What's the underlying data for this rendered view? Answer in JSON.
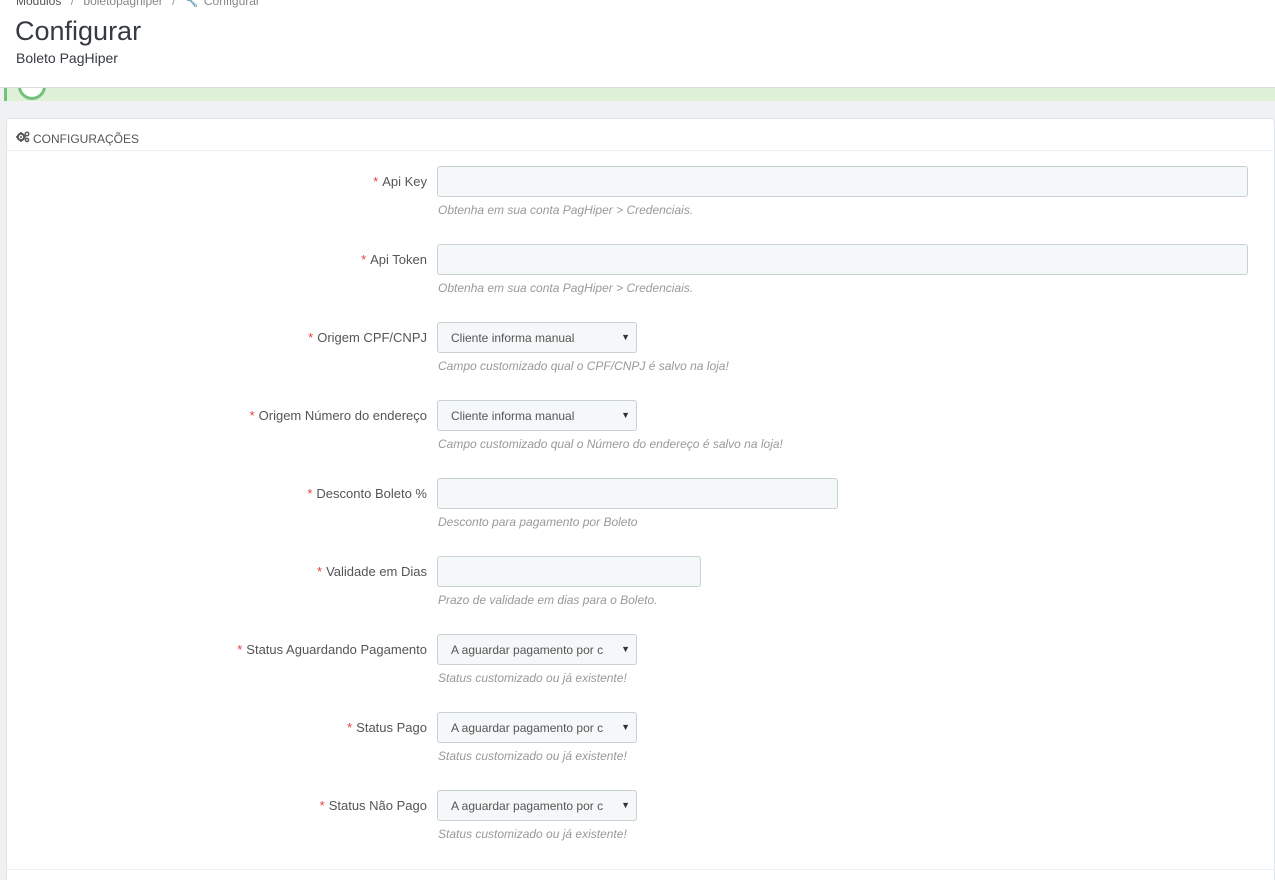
{
  "breadcrumb": {
    "items": [
      "Módulos",
      "boletopaghiper",
      "Configurar"
    ]
  },
  "header": {
    "title": "Configurar",
    "subtitle": "Boleto PagHiper"
  },
  "panel": {
    "heading": "CONFIGURAÇÕES",
    "heading_icon": "cogs-icon"
  },
  "form": {
    "required_mark": "*",
    "fields": [
      {
        "label": "Api Key",
        "value": "",
        "help": "Obtenha em sua conta PagHiper > Credenciais."
      },
      {
        "label": "Api Token",
        "value": "",
        "help": "Obtenha em sua conta PagHiper > Credenciais."
      },
      {
        "label": "Origem CPF/CNPJ",
        "value": "Cliente informa manual",
        "help": "Campo customizado qual o CPF/CNPJ é salvo na loja!"
      },
      {
        "label": "Origem Número do endereço",
        "value": "Cliente informa manual",
        "help": "Campo customizado qual o Número do endereço é salvo na loja!"
      },
      {
        "label": "Desconto Boleto %",
        "value": "",
        "help": "Desconto para pagamento por Boleto"
      },
      {
        "label": "Validade em Dias",
        "value": "",
        "help": "Prazo de validade em dias para o Boleto."
      },
      {
        "label": "Status Aguardando Pagamento",
        "value": "A aguardar pagamento por c",
        "help": "Status customizado ou já existente!"
      },
      {
        "label": "Status Pago",
        "value": "A aguardar pagamento por c",
        "help": "Status customizado ou já existente!"
      },
      {
        "label": "Status Não Pago",
        "value": "A aguardar pagamento por c",
        "help": "Status customizado ou já existente!"
      }
    ]
  },
  "colors": {
    "required": "#e3403a",
    "success_border": "#72c279",
    "success_bg": "#dff0d8"
  }
}
